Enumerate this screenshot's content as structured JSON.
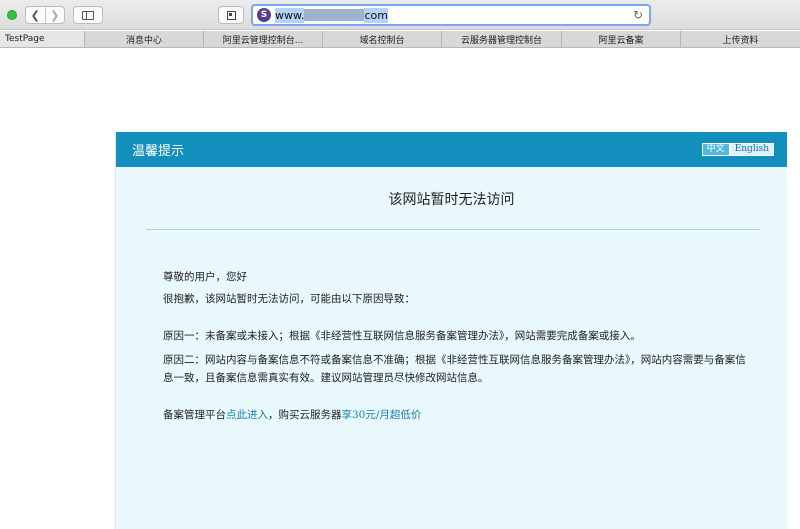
{
  "browser": {
    "url_prefix": "www.",
    "url_suffix": "com",
    "bookmarks": [
      {
        "label": "TestPage"
      },
      {
        "label": "消息中心"
      },
      {
        "label": "阿里云管理控制台..."
      },
      {
        "label": "域名控制台"
      },
      {
        "label": "云服务器管理控制台"
      },
      {
        "label": "阿里云备案"
      },
      {
        "label": "上传资料"
      }
    ],
    "site_badge": "S"
  },
  "notice": {
    "header_title": "温馨提示",
    "lang_zh": "中文",
    "lang_en": "English",
    "title": "该网站暂时无法访问",
    "greeting": "尊敬的用户，您好",
    "intro": "很抱歉，该网站暂时无法访问，可能由以下原因导致：",
    "reason1": "原因一：未备案或未接入；根据《非经营性互联网信息服务备案管理办法》，网站需要完成备案或接入。",
    "reason2": "原因二：网站内容与备案信息不符或备案信息不准确；根据《非经营性互联网信息服务备案管理办法》，网站内容需要与备案信息一致，且备案信息需真实有效。建议网站管理员尽快修改网站信息。",
    "footer_prefix": "备案管理平台",
    "footer_link1": "点此进入",
    "footer_middle": "，购买云服务器",
    "footer_link2": "享30元/月超低价"
  },
  "colors": {
    "header_bg": "#138fbd",
    "panel_bg": "#e9f8fd",
    "link": "#1a7fb4"
  }
}
